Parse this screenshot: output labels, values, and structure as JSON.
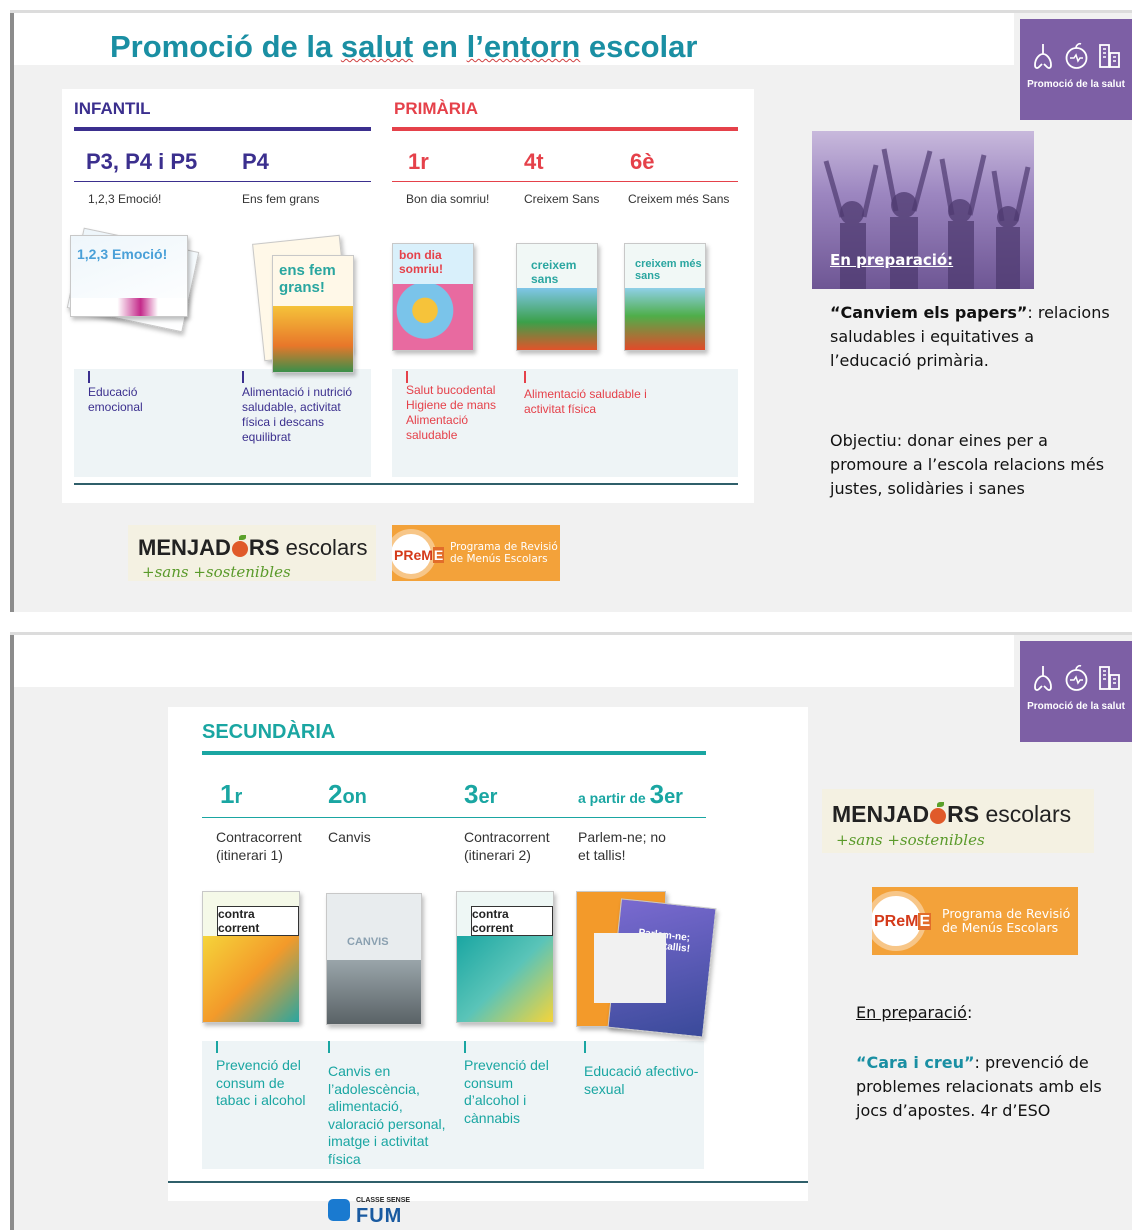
{
  "colors": {
    "purple": "#7d5fa5",
    "infantil": "#3b2f8e",
    "primaria": "#e5414a",
    "secundaria": "#1aa6a2",
    "title": "#1a8fa3"
  },
  "badge": {
    "label": "Promoció de la salut",
    "icons": [
      "lungs-icon",
      "apple-heart-icon",
      "buildings-icon"
    ]
  },
  "slide1": {
    "title_parts": [
      "Promoció de la ",
      "salut",
      " en ",
      "l’entorn",
      " escolar"
    ],
    "infantil": {
      "title": "INFANTIL",
      "grades": [
        "P3, P4 i P5",
        "P4"
      ],
      "programs": [
        "1,2,3 Emoció!",
        "Ens fem grans"
      ],
      "covers": [
        "1,2,3 Emoció!",
        "ens fem grans!"
      ],
      "topics": [
        "Educació emocional",
        "Alimentació i nutrició saludable, activitat física i descans equilibrat"
      ]
    },
    "primaria": {
      "title": "PRIMÀRIA",
      "grades": [
        "1r",
        "4t",
        "6è"
      ],
      "programs": [
        "Bon dia somriu!",
        "Creixem Sans",
        "Creixem més Sans"
      ],
      "covers": [
        "bon dia somriu!",
        "creixem sans",
        "creixem més sans"
      ],
      "topics": [
        "Salut bucodental Higiene de mans Alimentació saludable",
        "Alimentació saludable i activitat física"
      ]
    },
    "photo_label": "En preparació:",
    "side": {
      "bold": "“Canviem els papers”",
      "rest": ": relacions saludables i equitatives a l’educació primària.",
      "objective": "Objectiu: donar eines per a promoure a l’escola relacions més justes, solidàries i sanes"
    }
  },
  "menjadors": {
    "word_a": "MENJAD",
    "word_b": "RS",
    "word_c": " escolars",
    "tagline": "+sans +sostenibles"
  },
  "preme": {
    "acronym_a": "PReM",
    "acronym_b": "E",
    "line1": "Programa de Revisió",
    "line2": "de Menús Escolars"
  },
  "slide2": {
    "secundaria": {
      "title": "SECUNDÀRIA",
      "grades": [
        {
          "num": "1",
          "suf": "r",
          "pre": ""
        },
        {
          "num": "2",
          "suf": "on",
          "pre": ""
        },
        {
          "num": "3",
          "suf": "er",
          "pre": ""
        },
        {
          "num": "3",
          "suf": "er",
          "pre": "a partir de "
        }
      ],
      "programs": [
        "Contracorrent (itinerari 1)",
        "Canvis",
        "Contracorrent (itinerari 2)",
        "Parlem-ne; no et tallis!"
      ],
      "covers": [
        "contra corrent",
        "CANVIS",
        "contra corrent",
        "Parlem-ne; no et tallis!"
      ],
      "topics": [
        "Prevenció del consum de tabac i alcohol",
        "Canvis en l’adolescència, alimentació, valoració personal, imatge i activitat física",
        "Prevenció del consum d’alcohol i cànnabis",
        "Educació afectivo-sexual"
      ]
    },
    "fum": {
      "small": "CLASSE SENSE",
      "big": "FUM"
    },
    "prep": "En preparació",
    "prep_colon": ":",
    "side_bold": "“Cara i creu”",
    "side_rest": ": prevenció de problemes relacionats amb els jocs d’apostes. 4r d’ESO"
  }
}
